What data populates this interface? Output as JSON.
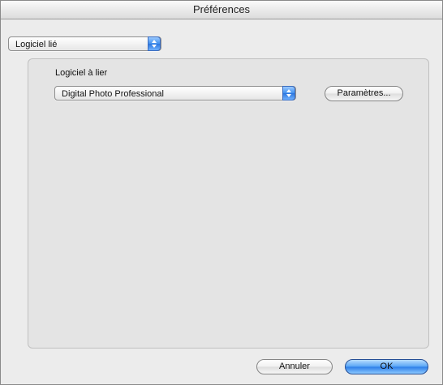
{
  "window": {
    "title": "Préférences"
  },
  "category_popup": {
    "selected": "Logiciel lié"
  },
  "linked_software": {
    "group_title": "Logiciel à lier",
    "app_popup": {
      "selected": "Digital Photo Professional"
    },
    "settings_button": "Paramètres..."
  },
  "buttons": {
    "cancel": "Annuler",
    "ok": "OK"
  },
  "icons": {
    "popup_arrows": "up-down-arrows-icon"
  },
  "colors": {
    "accent_blue": "#3f8fee",
    "window_bg": "#ececec",
    "group_bg": "#e4e4e4"
  }
}
